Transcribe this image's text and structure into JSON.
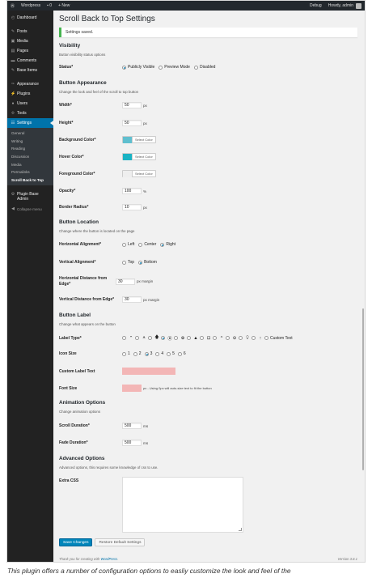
{
  "adminbar": {
    "site_name": "Wordpress",
    "comments_count": "0",
    "new_label": "+ New",
    "debug_label": "Debug",
    "howdy_label": "Howdy, admin"
  },
  "sidebar": {
    "items": [
      {
        "label": "Dashboard",
        "icon": "dashboard-icon"
      },
      {
        "label": "Posts",
        "icon": "pin-icon"
      },
      {
        "label": "Media",
        "icon": "media-icon"
      },
      {
        "label": "Pages",
        "icon": "page-icon"
      },
      {
        "label": "Comments",
        "icon": "comment-icon"
      },
      {
        "label": "Base Items",
        "icon": "pin-icon"
      },
      {
        "label": "Appearance",
        "icon": "brush-icon"
      },
      {
        "label": "Plugins",
        "icon": "plug-icon"
      },
      {
        "label": "Users",
        "icon": "user-icon"
      },
      {
        "label": "Tools",
        "icon": "wrench-icon"
      },
      {
        "label": "Settings",
        "icon": "settings-icon"
      }
    ],
    "submenu": [
      "General",
      "Writing",
      "Reading",
      "Discussion",
      "Media",
      "Permalinks",
      "Scroll Back to Top"
    ],
    "plugin_base_admin": "Plugin Base Admin",
    "collapse_label": "Collapse menu"
  },
  "page": {
    "title": "Scroll Back to Top Settings",
    "notice": "Settings saved."
  },
  "visibility": {
    "heading": "Visibility",
    "desc": "Button visibility status options",
    "status_label": "Status*",
    "options": [
      "Publicly Visible",
      "Preview Mode",
      "Disabled"
    ],
    "selected": 0
  },
  "appearance": {
    "heading": "Button Appearance",
    "desc": "Change the look and feel of the scroll to top button",
    "width_label": "Width*",
    "width_value": "50",
    "width_unit": "px",
    "height_label": "Height*",
    "height_value": "50",
    "height_unit": "px",
    "bg_label": "Background Color*",
    "bg_color": "#5fbfcf",
    "hover_label": "Hover Color*",
    "hover_color": "#1ab3c4",
    "fg_label": "Foreground Color*",
    "fg_color": "#eeeeee",
    "select_color": "Select Color",
    "opacity_label": "Opacity*",
    "opacity_value": "100",
    "opacity_unit": "%",
    "radius_label": "Border Radius*",
    "radius_value": "10",
    "radius_unit": "px"
  },
  "location": {
    "heading": "Button Location",
    "desc": "Change where the button is located on the page",
    "h_label": "Horizontal Alignment*",
    "h_options": [
      "Left",
      "Center",
      "Right"
    ],
    "h_selected": 2,
    "v_label": "Vertical Alignment*",
    "v_options": [
      "Top",
      "Bottom"
    ],
    "v_selected": 1,
    "h_dist_label": "Horizontal Distance from Edge*",
    "h_dist_value": "30",
    "h_dist_unit": "px margin",
    "v_dist_label": "Vertical Distance from Edge*",
    "v_dist_value": "30",
    "v_dist_unit": "px margin"
  },
  "label": {
    "heading": "Button Label",
    "desc": "Change what appears on the button",
    "type_label": "Label Type*",
    "type_glyphs": [
      "⌃",
      "⩚",
      "🡅",
      "⦿",
      "⊕",
      "▲",
      "⊡",
      "^",
      "⊖",
      "⍜",
      "↑"
    ],
    "type_selected": 3,
    "custom_text": "Custom Text",
    "icon_size_label": "Icon Size",
    "icon_sizes": [
      "1",
      "2",
      "3",
      "4",
      "5",
      "6"
    ],
    "icon_selected": 2,
    "custom_label_label": "Custom Label Text",
    "font_size_label": "Font Size",
    "font_size_hint": "px - Using 0px will auto-size text to fit the button"
  },
  "animation": {
    "heading": "Animation Options",
    "desc": "Change animation options",
    "scroll_label": "Scroll Duration*",
    "scroll_value": "500",
    "scroll_unit": "ms",
    "fade_label": "Fade Duration*",
    "fade_value": "500",
    "fade_unit": "ms"
  },
  "advanced": {
    "heading": "Advanced Options",
    "desc": "Advanced options, this requires some knowledge of css to use.",
    "css_label": "Extra CSS"
  },
  "buttons": {
    "save": "Save Changes",
    "restore": "Restore Default Settings"
  },
  "footer": {
    "thanks": "Thank you for creating with",
    "wp_link": "WordPress",
    "version": "Version 3.8.1"
  },
  "caption": "This plugin offers a number of configuration options to easliy customize the look and feel of the",
  "colors": {
    "accent": "#0073aa",
    "sidebar_bg": "#222222",
    "notice_green": "#46b450",
    "pink_field": "#f3b6b6"
  }
}
